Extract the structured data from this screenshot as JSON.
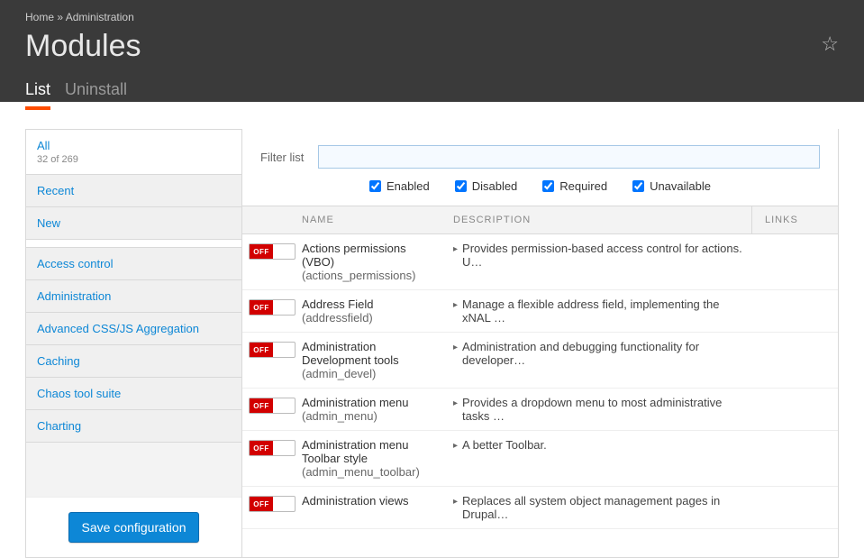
{
  "breadcrumb": {
    "home": "Home",
    "sep": "»",
    "admin": "Administration"
  },
  "page_title": "Modules",
  "tabs": [
    {
      "label": "List",
      "active": true
    },
    {
      "label": "Uninstall",
      "active": false
    }
  ],
  "sidebar": {
    "top": [
      {
        "label": "All",
        "active": true,
        "count": "32 of 269"
      },
      {
        "label": "Recent"
      },
      {
        "label": "New"
      }
    ],
    "cats": [
      {
        "label": "Access control"
      },
      {
        "label": "Administration"
      },
      {
        "label": "Advanced CSS/JS Aggregation"
      },
      {
        "label": "Caching"
      },
      {
        "label": "Chaos tool suite"
      },
      {
        "label": "Charting"
      }
    ],
    "save": "Save configuration"
  },
  "filter": {
    "label": "Filter list",
    "value": "",
    "checks": [
      {
        "label": "Enabled"
      },
      {
        "label": "Disabled"
      },
      {
        "label": "Required"
      },
      {
        "label": "Unavailable"
      }
    ]
  },
  "columns": {
    "name": "NAME",
    "desc": "DESCRIPTION",
    "links": "LINKS"
  },
  "toggle_off": "OFF",
  "modules": [
    {
      "name": "Actions permissions (VBO)",
      "code": "(actions_permissions)",
      "desc": "Provides permission-based access control for actions. U…"
    },
    {
      "name": "Address Field",
      "code": "(addressfield)",
      "desc": "Manage a flexible address field, implementing the xNAL …"
    },
    {
      "name": "Administration Development tools",
      "code": "(admin_devel)",
      "desc": "Administration and debugging functionality for developer…"
    },
    {
      "name": "Administration menu",
      "code": "(admin_menu)",
      "desc": "Provides a dropdown menu to most administrative tasks …"
    },
    {
      "name": "Administration menu Toolbar style",
      "code": "(admin_menu_toolbar)",
      "desc": "A better Toolbar."
    },
    {
      "name": "Administration views",
      "code": "",
      "desc": "Replaces all system object management pages in Drupal…"
    }
  ]
}
